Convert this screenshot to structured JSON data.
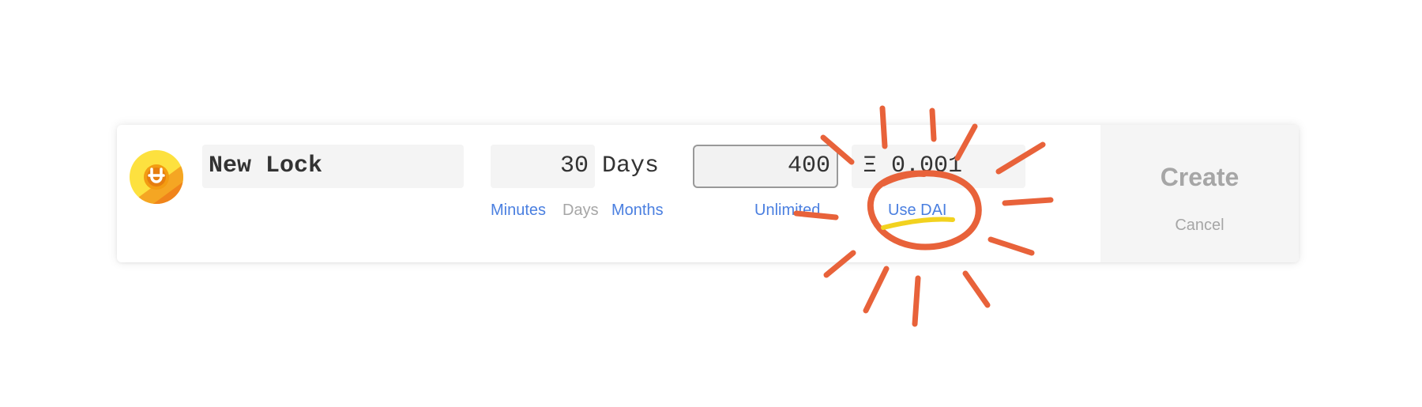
{
  "lock_form": {
    "logo_icon": "unlock-logo-icon",
    "name": "New Lock",
    "duration": {
      "value": "30",
      "unit": "Days",
      "options": [
        "Minutes",
        "Days",
        "Months"
      ],
      "selected": "Days"
    },
    "keys": {
      "value": "400",
      "unlimited_label": "Unlimited"
    },
    "price": {
      "value": "Ξ 0.001",
      "use_dai_label": "Use DAI"
    },
    "actions": {
      "create_label": "Create",
      "cancel_label": "Cancel"
    }
  },
  "annotation": {
    "type": "hand-drawn sun circle with rays around Use DAI",
    "stroke_color": "#e8623a",
    "underline_color": "#f2d21f"
  },
  "colors": {
    "link": "#4a7fe0",
    "muted": "#a6a6a6",
    "field_bg": "#f4f4f4",
    "logo_yellow": "#fde13f",
    "logo_orange": "#f39c12"
  }
}
